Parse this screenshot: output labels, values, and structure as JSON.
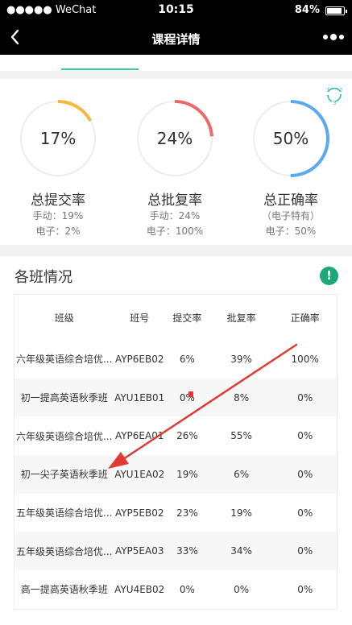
{
  "status_bar": {
    "carrier": "●●●●● WeChat",
    "time": "10:15",
    "battery": "84%"
  },
  "nav": {
    "title": "课程详情",
    "back_icon": "chevron-left-icon",
    "more_icon": "more-dots-icon"
  },
  "colors": {
    "accent": "#3cc6a8",
    "submit": "#f5b73c",
    "review": "#f0676a",
    "correct": "#5aa9f2",
    "info": "#1aa977",
    "arrow": "#e03a33"
  },
  "stats": [
    {
      "value": "17%",
      "fraction": 0.17,
      "label": "总提交率",
      "lines": [
        "手动：19%",
        "电子：2%"
      ]
    },
    {
      "value": "24%",
      "fraction": 0.24,
      "label": "总批复率",
      "lines": [
        "手动：24%",
        "电子：100%"
      ]
    },
    {
      "value": "50%",
      "fraction": 0.5,
      "label": "总正确率",
      "lines": [
        "（电子特有）",
        "电子：50%"
      ]
    }
  ],
  "classes": {
    "title": "各班情况",
    "info_icon_text": "!",
    "headers": [
      "班级",
      "班号",
      "提交率",
      "批复率",
      "正确率"
    ],
    "rows": [
      [
        "六年级英语综合培优...",
        "AYP6EB02",
        "6%",
        "39%",
        "100%"
      ],
      [
        "初一提高英语秋季班",
        "AYU1EB01",
        "0%",
        "8%",
        "0%"
      ],
      [
        "六年级英语综合培优...",
        "AYP6EA01",
        "26%",
        "55%",
        "0%"
      ],
      [
        "初一尖子英语秋季班",
        "AYU1EA02",
        "19%",
        "6%",
        "0%"
      ],
      [
        "五年级英语综合培优...",
        "AYP5EB02",
        "23%",
        "19%",
        "0%"
      ],
      [
        "五年级英语综合培优...",
        "AYP5EA03",
        "33%",
        "34%",
        "0%"
      ],
      [
        "高一提高英语秋季班",
        "AYU4EB02",
        "0%",
        "0%",
        "0%"
      ]
    ]
  }
}
